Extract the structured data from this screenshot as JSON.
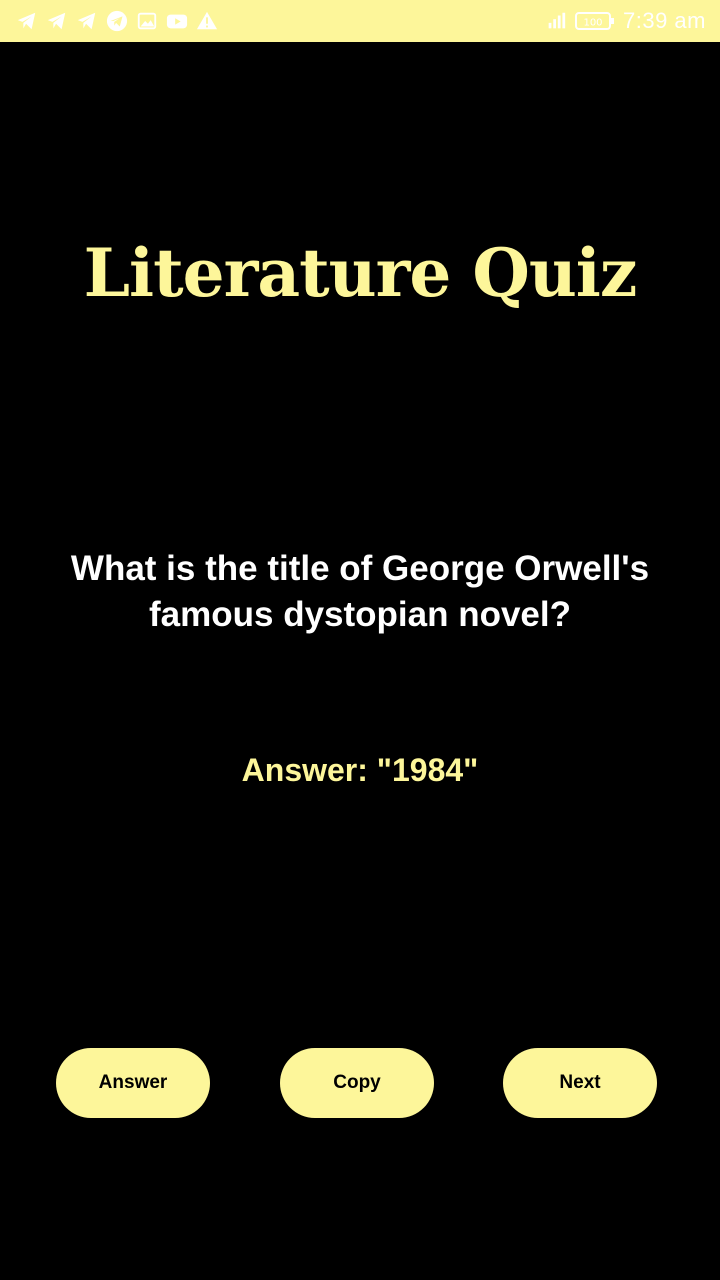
{
  "status_bar": {
    "left_icons": [
      "telegram-icon",
      "telegram-icon",
      "telegram-icon",
      "telegram-circle-icon",
      "image-icon",
      "youtube-icon",
      "warning-icon"
    ],
    "right_icons": [
      "signal-icon",
      "battery-icon"
    ],
    "battery_text": "100",
    "time": "7:39 am",
    "background": "#fdf69a"
  },
  "title": "Literature Quiz",
  "question": "What is the title of George Orwell's famous dystopian novel?",
  "answer": "Answer: \"1984\"",
  "buttons": {
    "answer_label": "Answer",
    "copy_label": "Copy",
    "next_label": "Next"
  },
  "colors": {
    "accent": "#fdf69a",
    "background": "#000000",
    "question_text": "#ffffff"
  }
}
